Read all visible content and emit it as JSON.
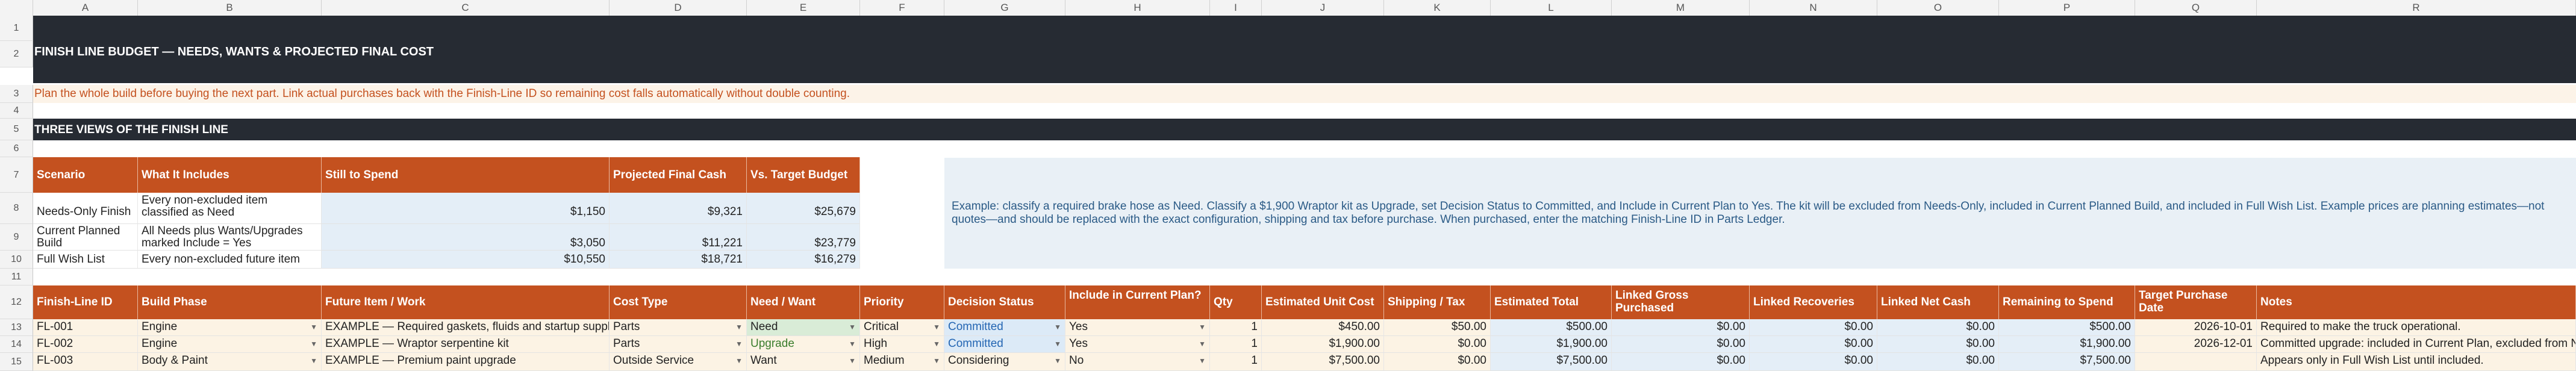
{
  "columns": [
    "A",
    "B",
    "C",
    "D",
    "E",
    "F",
    "G",
    "H",
    "I",
    "J",
    "K",
    "L",
    "M",
    "N",
    "O",
    "P",
    "Q",
    "R"
  ],
  "rows": [
    "1",
    "2",
    "3",
    "4",
    "5",
    "6",
    "7",
    "8",
    "9",
    "10",
    "11",
    "12",
    "13",
    "14",
    "15"
  ],
  "title": "FINISH LINE BUDGET — NEEDS, WANTS & PROJECTED FINAL COST",
  "subtitle": "Plan the whole build before buying the next part. Link actual purchases back with the Finish-Line ID so remaining cost falls automatically without double counting.",
  "section_title": "THREE VIEWS OF THE FINISH LINE",
  "views": {
    "headers": [
      "Scenario",
      "What It Includes",
      "Still to Spend",
      "Projected Final Cash",
      "Vs. Target Budget"
    ],
    "rows": [
      {
        "scenario": "Needs-Only Finish",
        "includes": "Every non-excluded item classified as Need",
        "still": "$1,150",
        "projected": "$9,321",
        "vs": "$25,679"
      },
      {
        "scenario": "Current Planned Build",
        "includes": "All Needs plus Wants/Upgrades marked Include = Yes",
        "still": "$3,050",
        "projected": "$11,221",
        "vs": "$23,779"
      },
      {
        "scenario": "Full Wish List",
        "includes": "Every non-excluded future item",
        "still": "$10,550",
        "projected": "$18,721",
        "vs": "$16,279"
      }
    ]
  },
  "example_note": "Example: classify a required brake hose as Need. Classify a $1,900 Wraptor kit as Upgrade, set Decision Status to Committed, and Include in Current Plan to Yes. The kit will be excluded from Needs-Only, included in Current Planned Build, and included in Full Wish List. Example prices are planning estimates—not quotes—and should be replaced with the exact configuration, shipping and tax before purchase. When purchased, enter the matching Finish-Line ID in Parts Ledger.",
  "items": {
    "headers": [
      "Finish-Line ID",
      "Build Phase",
      "Future Item / Work",
      "Cost Type",
      "Need / Want",
      "Priority",
      "Decision Status",
      "Include in Current Plan?",
      "Qty",
      "Estimated Unit Cost",
      "Shipping / Tax",
      "Estimated Total",
      "Linked Gross Purchased",
      "Linked Recoveries",
      "Linked Net Cash",
      "Remaining to Spend",
      "Target Purchase Date",
      "Notes"
    ],
    "rows": [
      {
        "id": "FL-001",
        "phase": "Engine",
        "item": "EXAMPLE — Required gaskets, fluids and startup supplies",
        "cost_type": "Parts",
        "need": "Need",
        "priority": "Critical",
        "status": "Committed",
        "include": "Yes",
        "qty": "1",
        "unit": "$450.00",
        "ship": "$50.00",
        "total": "$500.00",
        "gross": "$0.00",
        "recov": "$0.00",
        "net": "$0.00",
        "remain": "$500.00",
        "date": "2026-10-01",
        "notes": "Required to make the truck operational."
      },
      {
        "id": "FL-002",
        "phase": "Engine",
        "item": "EXAMPLE — Wraptor serpentine kit",
        "cost_type": "Parts",
        "need": "Upgrade",
        "priority": "High",
        "status": "Committed",
        "include": "Yes",
        "qty": "1",
        "unit": "$1,900.00",
        "ship": "$0.00",
        "total": "$1,900.00",
        "gross": "$0.00",
        "recov": "$0.00",
        "net": "$0.00",
        "remain": "$1,900.00",
        "date": "2026-12-01",
        "notes": "Committed upgrade: included in Current Plan, excluded from Needs-Only."
      },
      {
        "id": "FL-003",
        "phase": "Body & Paint",
        "item": "EXAMPLE — Premium paint upgrade",
        "cost_type": "Outside Service",
        "need": "Want",
        "priority": "Medium",
        "status": "Considering",
        "include": "No",
        "qty": "1",
        "unit": "$7,500.00",
        "ship": "$0.00",
        "total": "$7,500.00",
        "gross": "$0.00",
        "recov": "$0.00",
        "net": "$0.00",
        "remain": "$7,500.00",
        "date": "",
        "notes": "Appears only in Full Wish List until included."
      }
    ]
  },
  "colors": {
    "dark_band": "#262b33",
    "header_orange": "#c4511f",
    "note_text": "#c4511f",
    "input_blue": "#e4eef7",
    "peach": "#fcf3e4"
  }
}
